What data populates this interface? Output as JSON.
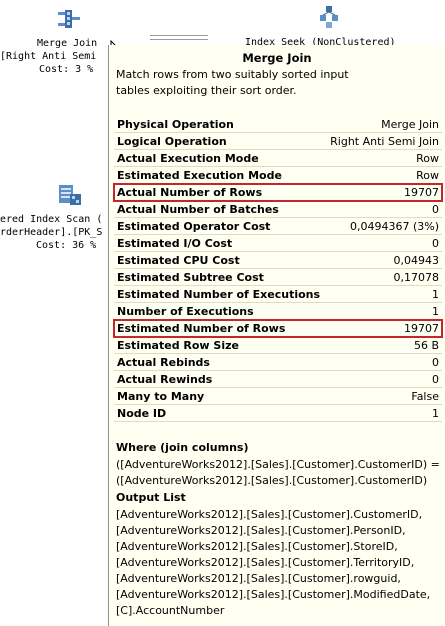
{
  "plan": {
    "merge_join_node": {
      "name": "Merge Join",
      "subtitle": "[Right Anti Semi",
      "cost": "Cost: 3 %"
    },
    "index_seek_node": {
      "name": "Index Seek (NonClustered)"
    },
    "clustered_scan_node": {
      "line1": "ered Index Scan (",
      "line2": "rderHeader].[PK_S",
      "cost": "Cost: 36 %"
    }
  },
  "tooltip": {
    "title": "Merge Join",
    "description": "Match rows from two suitably sorted input tables exploiting their sort order.",
    "properties": [
      {
        "label": "Physical Operation",
        "value": "Merge Join",
        "highlight": false
      },
      {
        "label": "Logical Operation",
        "value": "Right Anti Semi Join",
        "highlight": false
      },
      {
        "label": "Actual Execution Mode",
        "value": "Row",
        "highlight": false
      },
      {
        "label": "Estimated Execution Mode",
        "value": "Row",
        "highlight": false
      },
      {
        "label": "Actual Number of Rows",
        "value": "19707",
        "highlight": true
      },
      {
        "label": "Actual Number of Batches",
        "value": "0",
        "highlight": false
      },
      {
        "label": "Estimated Operator Cost",
        "value": "0,0494367 (3%)",
        "highlight": false
      },
      {
        "label": "Estimated I/O Cost",
        "value": "0",
        "highlight": false
      },
      {
        "label": "Estimated CPU Cost",
        "value": "0,04943",
        "highlight": false
      },
      {
        "label": "Estimated Subtree Cost",
        "value": "0,17078",
        "highlight": false
      },
      {
        "label": "Estimated Number of Executions",
        "value": "1",
        "highlight": false
      },
      {
        "label": "Number of Executions",
        "value": "1",
        "highlight": false
      },
      {
        "label": "Estimated Number of Rows",
        "value": "19707",
        "highlight": true
      },
      {
        "label": "Estimated Row Size",
        "value": "56 B",
        "highlight": false
      },
      {
        "label": "Actual Rebinds",
        "value": "0",
        "highlight": false
      },
      {
        "label": "Actual Rewinds",
        "value": "0",
        "highlight": false
      },
      {
        "label": "Many to Many",
        "value": "False",
        "highlight": false
      },
      {
        "label": "Node ID",
        "value": "1",
        "highlight": false
      }
    ],
    "where_title": "Where (join columns)",
    "where_lines": [
      "([AdventureWorks2012].[Sales].[Customer].CustomerID) =",
      "([AdventureWorks2012].[Sales].[Customer].CustomerID)"
    ],
    "output_title": "Output List",
    "output_lines": [
      "[AdventureWorks2012].[Sales].[Customer].CustomerID,",
      "[AdventureWorks2012].[Sales].[Customer].PersonID,",
      "[AdventureWorks2012].[Sales].[Customer].StoreID,",
      "[AdventureWorks2012].[Sales].[Customer].TerritoryID,",
      "[AdventureWorks2012].[Sales].[Customer].rowguid,",
      "[AdventureWorks2012].[Sales].[Customer].ModifiedDate,",
      "[C].AccountNumber"
    ],
    "highlight_color": "#c1272d"
  }
}
